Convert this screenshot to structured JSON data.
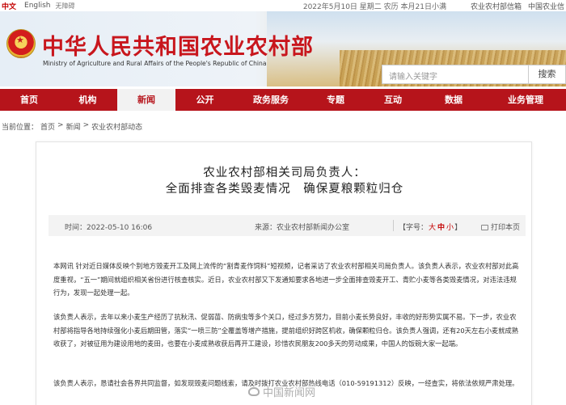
{
  "topbar": {
    "lang_cn": "中文",
    "lang_en": "English",
    "accessibility": "无障碍",
    "date": "2022年5月10日 星期二 农历 本月21日小满",
    "links": [
      "农业农村部信箱",
      "中国农业信"
    ]
  },
  "header": {
    "title": "中华人民共和国农业农村部",
    "subtitle": "Ministry of Agriculture and Rural Affairs of the People's Republic of China",
    "search_placeholder": "请输入关键字",
    "search_button": "搜索"
  },
  "nav": {
    "items": [
      "首页",
      "机构",
      "新闻",
      "公开",
      "政务服务",
      "专题",
      "互动",
      "数据",
      "业务管理"
    ],
    "active": "新闻"
  },
  "breadcrumb": {
    "prefix": "当前位置：",
    "items": [
      "首页",
      "新闻",
      "农业农村部动态"
    ],
    "separator": ">"
  },
  "article": {
    "kicker": "农业农村部相关司局负责人：",
    "headline": "全面排查各类毁麦情况　确保夏粮颗粒归仓",
    "time": "时间：2022-05-10 16:06",
    "source": "来源：农业农村部新闻办公室",
    "fontsize_label": "【字号：",
    "fontsize_options": [
      "大",
      "中",
      "小"
    ],
    "fontsize_close": "】",
    "print_label": "打印本页",
    "paragraphs": [
      "本网讯 针对近日媒体反映个别地方毁麦开工及网上流传的“割青麦作饲料”短视频，记者采访了农业农村部相关司局负责人。该负责人表示，农业农村部对此高度重视，“五一”期间就组织相关省份进行核查核实。近日，农业农村部又下发通知要求各地进一步全面排查毁麦开工、青贮小麦等各类毁麦情况，对违法违规行为，发现一起处理一起。",
      "该负责人表示，去年以来小麦生产经历了抗秋汛、促弱苗、防病虫等多个关口，经过多方努力，目前小麦长势良好，丰收的好形势实属不易。下一步，农业农村部将指导各地持续强化小麦后期田管，落实“一喷三防”全覆盖等增产措施，提前组织好跨区机收，确保颗粒归仓。该负责人强调，还有20天左右小麦就成熟收获了，对被征用为建设用地的麦田，也要在小麦成熟收获后再开工建设，珍惜农民朋友200多天的劳动成果，中国人的饭碗大家一起端。",
      "该负责人表示，恳请社会各界共同监督，如发现毁麦问题线索，请及时拨打农业农村部热线电话（010-59191312）反映，一经查实，将依法依规严肃处理。"
    ]
  },
  "watermark": "中国新闻网",
  "colors": {
    "brand_red": "#b6141b",
    "title_red": "#c8161d",
    "nav_active_bg": "#f2f2f2"
  }
}
